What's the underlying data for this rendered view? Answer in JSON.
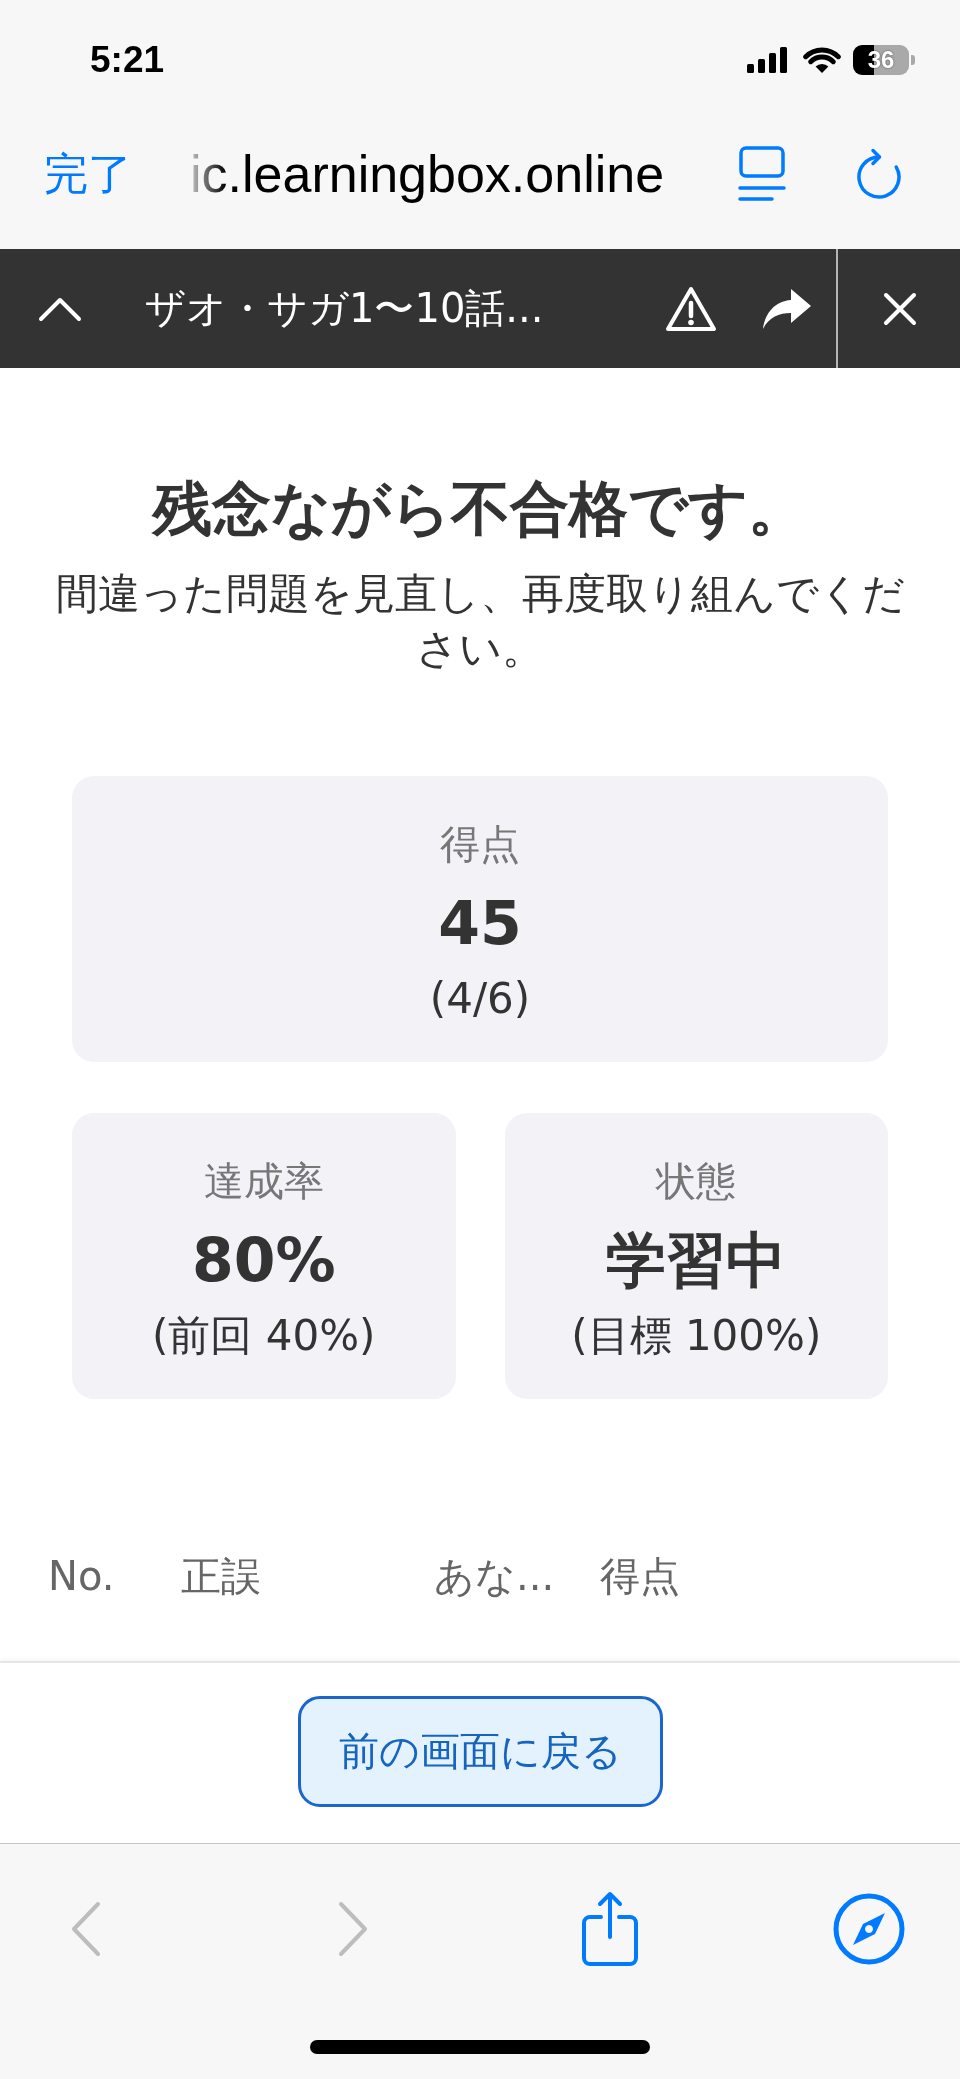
{
  "status_bar": {
    "time": "5:21",
    "battery": "36"
  },
  "browser_bar": {
    "done_button": "完了",
    "url": "ic.learningbox.online"
  },
  "course_bar": {
    "title": "ザオ・サガ1〜10話..."
  },
  "result": {
    "title": "残念ながら不合格です。",
    "message": "間違った問題を見直し、再度取り組んでください。"
  },
  "score_card": {
    "label": "得点",
    "value": "45",
    "detail": "(4/6)"
  },
  "stat_cards": [
    {
      "label": "達成率",
      "value": "80%",
      "detail": "(前回 40%)"
    },
    {
      "label": "状態",
      "value": "学習中",
      "detail": "(目標 100%)"
    }
  ],
  "table": {
    "columns": [
      "No.",
      "正誤",
      "あな...",
      "得点"
    ]
  },
  "footer": {
    "back_button": "前の画面に戻る"
  },
  "toolbar": {
    "buttons": [
      {
        "kind": "back",
        "disabled": true
      },
      {
        "kind": "forward",
        "disabled": true
      },
      {
        "kind": "share",
        "disabled": false
      },
      {
        "kind": "compass",
        "disabled": false
      }
    ]
  }
}
